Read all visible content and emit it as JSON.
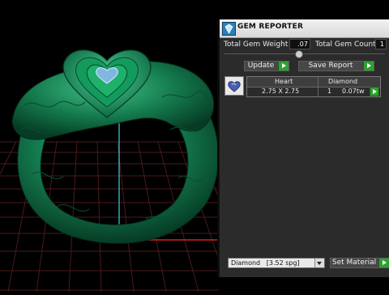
{
  "panel": {
    "title": "GEM REPORTER",
    "total_gem_weight_label": "Total Gem Weight",
    "total_gem_weight_value": ".07",
    "total_gem_count_label": "Total Gem Count",
    "total_gem_count_value": "1",
    "update_label": "Update",
    "save_report_label": "Save Report",
    "gem": {
      "shape": "Heart",
      "dimensions": "2.75 X 2.75",
      "material": "Diamond",
      "count": "1",
      "weight": "0.07tw"
    },
    "material_select_value": "Diamond",
    "material_select_sg": "[3.52 spg]",
    "set_material_label": "Set Material"
  },
  "colors": {
    "ring_green": "#1a8a57",
    "grid": "#4d1d1d",
    "panel_bg": "#2b2b2b",
    "play_green": "#2fa12f",
    "gem_blue": "#7fb7e0"
  },
  "icons": [
    "gem-reporter-icon",
    "heart-gem-icon",
    "play-arrow-icon",
    "dropdown-arrow-icon"
  ]
}
